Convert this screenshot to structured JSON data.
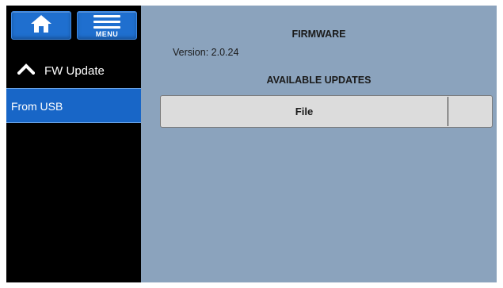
{
  "sidebar": {
    "menu_label": "MENU",
    "fw_update_label": "FW Update",
    "from_usb_label": "From USB"
  },
  "main": {
    "title": "FIRMWARE",
    "version_text": "Version: 2.0.24",
    "updates_heading": "AVAILABLE UPDATES",
    "table": {
      "columns": [
        "File",
        ""
      ]
    }
  },
  "colors": {
    "accent_blue": "#1f6fcf",
    "selected_blue": "#1866c7",
    "panel_background": "#8ba3bd",
    "sidebar_background": "#000000",
    "table_header_background": "#dcdcdc"
  },
  "icons": {
    "home": "home-icon",
    "menu": "hamburger-menu-icon",
    "fw_update": "chevron-up-icon"
  }
}
